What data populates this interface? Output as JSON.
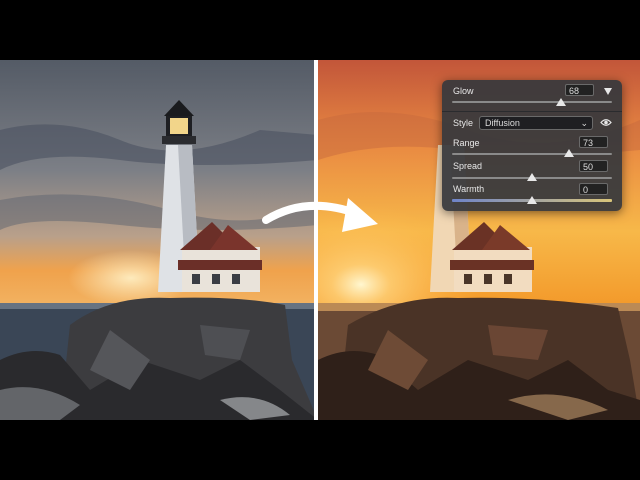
{
  "panel": {
    "glow": {
      "label": "Glow",
      "value": "68",
      "level": 0.68
    },
    "style": {
      "label": "Style",
      "selected": "Diffusion"
    },
    "range": {
      "label": "Range",
      "value": "73",
      "level": 0.73
    },
    "spread": {
      "label": "Spread",
      "value": "50",
      "level": 0.5
    },
    "warmth": {
      "label": "Warmth",
      "value": "0",
      "level": 0.5
    }
  },
  "icons": [
    "collapse-triangle-icon",
    "eye-icon",
    "chevron-down-icon",
    "curved-arrow-icon"
  ],
  "colors": {
    "panel_bg": "#36383c",
    "before_sky": "#6d7584",
    "after_sky": "#f2a23a"
  }
}
